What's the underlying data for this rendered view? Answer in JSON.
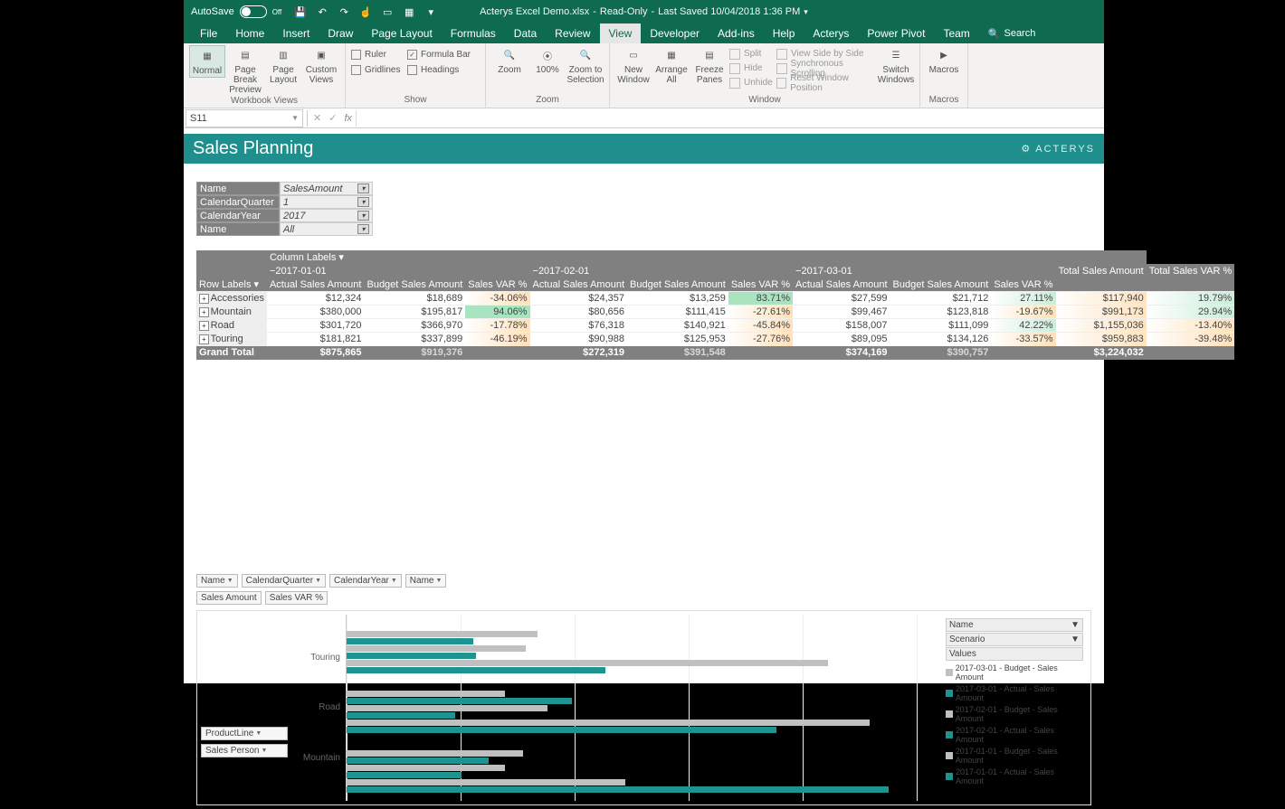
{
  "titlebar": {
    "autosave_label": "AutoSave",
    "autosave_state": "Off",
    "doc_name": "Acterys Excel Demo.xlsx",
    "readonly": "Read-Only",
    "last_saved": "Last Saved 10/04/2018 1:36 PM"
  },
  "tabs": [
    "File",
    "Home",
    "Insert",
    "Draw",
    "Page Layout",
    "Formulas",
    "Data",
    "Review",
    "View",
    "Developer",
    "Add-ins",
    "Help",
    "Acterys",
    "Power Pivot",
    "Team"
  ],
  "active_tab": "View",
  "search_label": "Search",
  "ribbon": {
    "workbook_views": {
      "label": "Workbook Views",
      "buttons": [
        "Normal",
        "Page Break Preview",
        "Page Layout",
        "Custom Views"
      ]
    },
    "show": {
      "label": "Show",
      "ruler": "Ruler",
      "formula_bar": "Formula Bar",
      "gridlines": "Gridlines",
      "headings": "Headings"
    },
    "zoom": {
      "label": "Zoom",
      "zoom_btn": "Zoom",
      "hundred": "100%",
      "to_sel": "Zoom to Selection"
    },
    "window": {
      "label": "Window",
      "new_window": "New Window",
      "arrange": "Arrange All",
      "freeze": "Freeze Panes",
      "split": "Split",
      "hide": "Hide",
      "unhide": "Unhide",
      "side": "View Side by Side",
      "sync": "Synchronous Scrolling",
      "reset": "Reset Window Position",
      "switch": "Switch Windows"
    },
    "macros": {
      "label": "Macros",
      "btn": "Macros"
    }
  },
  "namebox": "S11",
  "banner_title": "Sales Planning",
  "brand": "ACTERYS",
  "filters": [
    {
      "label": "Name",
      "val": "SalesAmount"
    },
    {
      "label": "CalendarQuarter",
      "val": "1"
    },
    {
      "label": "CalendarYear",
      "val": "2017"
    },
    {
      "label": "Name",
      "val": "All"
    }
  ],
  "pivot": {
    "column_labels": "Column Labels",
    "row_labels": "Row Labels",
    "dates": [
      "2017-01-01",
      "2017-02-01",
      "2017-03-01"
    ],
    "sub": [
      "Actual Sales Amount",
      "Budget Sales Amount",
      "Sales VAR %"
    ],
    "totals_h": [
      "Total Sales Amount",
      "Total Sales VAR %"
    ],
    "rows": [
      {
        "name": "Accessories",
        "v": [
          "$12,324",
          "$18,689",
          "-34.06%",
          "$24,357",
          "$13,259",
          "83.71%",
          "$27,599",
          "$21,712",
          "27.11%",
          "$117,940",
          "19.79%"
        ]
      },
      {
        "name": "Mountain",
        "v": [
          "$380,000",
          "$195,817",
          "94.06%",
          "$80,656",
          "$111,415",
          "-27.61%",
          "$99,467",
          "$123,818",
          "-19.67%",
          "$991,173",
          "29.94%"
        ]
      },
      {
        "name": "Road",
        "v": [
          "$301,720",
          "$366,970",
          "-17.78%",
          "$76,318",
          "$140,921",
          "-45.84%",
          "$158,007",
          "$111,099",
          "42.22%",
          "$1,155,036",
          "-13.40%"
        ]
      },
      {
        "name": "Touring",
        "v": [
          "$181,821",
          "$337,899",
          "-46.19%",
          "$90,988",
          "$125,953",
          "-27.76%",
          "$89,095",
          "$134,126",
          "-33.57%",
          "$959,883",
          "-39.48%"
        ]
      }
    ],
    "grand": {
      "name": "Grand Total",
      "v": [
        "$875,865",
        "$919,376",
        "",
        "$272,319",
        "$391,548",
        "",
        "$374,169",
        "$390,757",
        "",
        "$3,224,032",
        ""
      ]
    }
  },
  "chart_filters_row1": [
    "Name",
    "CalendarQuarter",
    "CalendarYear",
    "Name"
  ],
  "chart_filters_row2": [
    "Sales Amount",
    "Sales VAR %"
  ],
  "chart_left_filters": [
    "ProductLine",
    "Sales Person"
  ],
  "legend_headers": [
    "Name",
    "Scenario",
    "Values"
  ],
  "legend_items": [
    {
      "c": "#c0c0c0",
      "t": "2017-03-01 - Budget - Sales Amount"
    },
    {
      "c": "#1e9491",
      "t": "2017-03-01 - Actual - Sales Amount"
    },
    {
      "c": "#c0c0c0",
      "t": "2017-02-01 - Budget - Sales Amount"
    },
    {
      "c": "#1e9491",
      "t": "2017-02-01 - Actual - Sales Amount"
    },
    {
      "c": "#c0c0c0",
      "t": "2017-01-01 - Budget - Sales Amount"
    },
    {
      "c": "#1e9491",
      "t": "2017-01-01 - Actual - Sales Amount"
    }
  ],
  "chart_data": {
    "type": "bar",
    "orientation": "horizontal",
    "categories": [
      "Touring",
      "Road",
      "Mountain"
    ],
    "series": [
      {
        "name": "2017-03-01 Budget",
        "color": "#c0c0c0",
        "values": [
          134126,
          111099,
          123818
        ]
      },
      {
        "name": "2017-03-01 Actual",
        "color": "#1e9491",
        "values": [
          89095,
          158007,
          99467
        ]
      },
      {
        "name": "2017-02-01 Budget",
        "color": "#c0c0c0",
        "values": [
          125953,
          140921,
          111415
        ]
      },
      {
        "name": "2017-02-01 Actual",
        "color": "#1e9491",
        "values": [
          90988,
          76318,
          80656
        ]
      },
      {
        "name": "2017-01-01 Budget",
        "color": "#c0c0c0",
        "values": [
          337899,
          366970,
          195817
        ]
      },
      {
        "name": "2017-01-01 Actual",
        "color": "#1e9491",
        "values": [
          181821,
          301720,
          380000
        ]
      }
    ],
    "xlim": [
      0,
      400000
    ]
  }
}
